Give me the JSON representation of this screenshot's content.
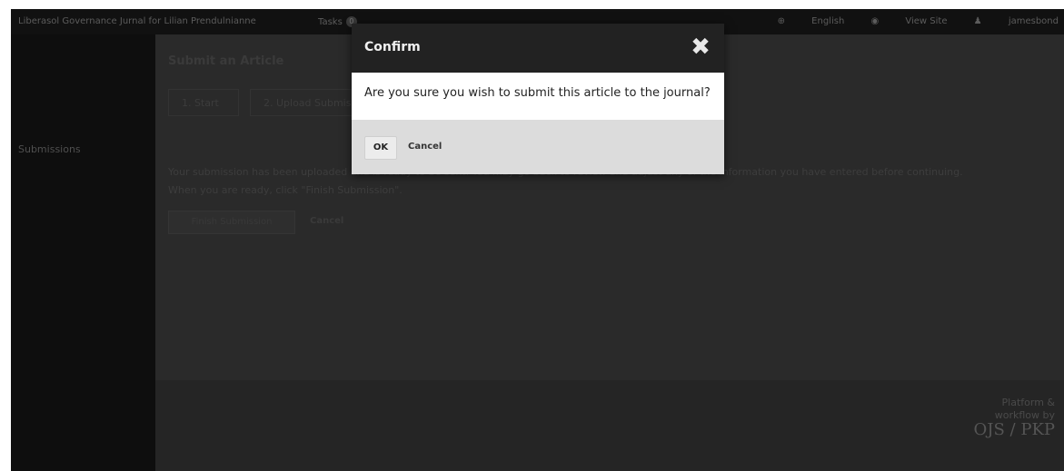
{
  "topbar": {
    "journal_name": "Liberasol Governance Jurnal for Lilian Prendulnianne",
    "tasks_label": "Tasks",
    "tasks_count": "0",
    "language": "English",
    "view_site": "View Site",
    "username": "jamesbond"
  },
  "sidebar": {
    "items": [
      {
        "label": "Submissions"
      }
    ]
  },
  "main": {
    "page_title": "Submit an Article",
    "tabs": [
      {
        "label": "1. Start"
      },
      {
        "label": "2. Upload Submission"
      }
    ],
    "message_line1": "Your submission has been uploaded and is ready to be sent. You may go back to review and adjust any of the information you have entered before continuing.",
    "message_line2": "When you are ready, click \"Finish Submission\".",
    "finish_label": "Finish Submission",
    "cancel_label": "Cancel"
  },
  "footer": {
    "platform_line1": "Platform &",
    "platform_line2": "workflow by",
    "logo": "OJS / PKP"
  },
  "modal": {
    "title": "Confirm",
    "close_glyph": "✖",
    "message": "Are you sure you wish to submit this article to the journal?",
    "ok_label": "OK",
    "cancel_label": "Cancel"
  }
}
